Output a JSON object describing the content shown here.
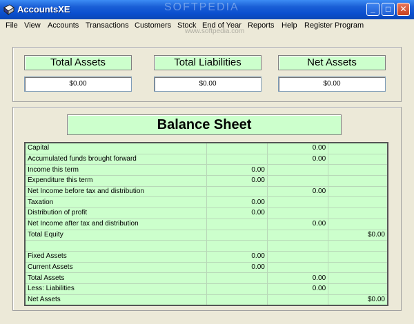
{
  "window": {
    "title": "AccountsXE",
    "watermark": "SOFTPEDIA",
    "watermark_url": "www.softpedia.com"
  },
  "menu": [
    "File",
    "View",
    "Accounts",
    "Transactions",
    "Customers",
    "Stock",
    "End of Year",
    "Reports",
    "Help",
    "Register Program"
  ],
  "summary": {
    "total_assets": {
      "label": "Total Assets",
      "value": "$0.00"
    },
    "total_liabilities": {
      "label": "Total Liabilities",
      "value": "$0.00"
    },
    "net_assets": {
      "label": "Net Assets",
      "value": "$0.00"
    }
  },
  "balance_sheet": {
    "title": "Balance Sheet",
    "rows": [
      {
        "label": "Capital",
        "c1": "",
        "c2": "0.00",
        "c3": ""
      },
      {
        "label": "Accumulated funds brought forward",
        "c1": "",
        "c2": "0.00",
        "c3": ""
      },
      {
        "label": "Income this term",
        "c1": "0.00",
        "c2": "",
        "c3": ""
      },
      {
        "label": "Expenditure this term",
        "c1": "0.00",
        "c2": "",
        "c3": ""
      },
      {
        "label": "Net Income before tax and distribution",
        "c1": "",
        "c2": "0.00",
        "c3": ""
      },
      {
        "label": "Taxation",
        "c1": "0.00",
        "c2": "",
        "c3": ""
      },
      {
        "label": "Distribution of profit",
        "c1": "0.00",
        "c2": "",
        "c3": ""
      },
      {
        "label": "Net Income after tax and distribution",
        "c1": "",
        "c2": "0.00",
        "c3": ""
      },
      {
        "label": "Total Equity",
        "c1": "",
        "c2": "",
        "c3": "$0.00"
      },
      {
        "label": "",
        "c1": "",
        "c2": "",
        "c3": ""
      },
      {
        "label": "Fixed Assets",
        "c1": "0.00",
        "c2": "",
        "c3": ""
      },
      {
        "label": "Current Assets",
        "c1": "0.00",
        "c2": "",
        "c3": ""
      },
      {
        "label": "Total Assets",
        "c1": "",
        "c2": "0.00",
        "c3": ""
      },
      {
        "label": "Less: Liabilities",
        "c1": "",
        "c2": "0.00",
        "c3": ""
      },
      {
        "label": "Net Assets",
        "c1": "",
        "c2": "",
        "c3": "$0.00"
      }
    ]
  }
}
